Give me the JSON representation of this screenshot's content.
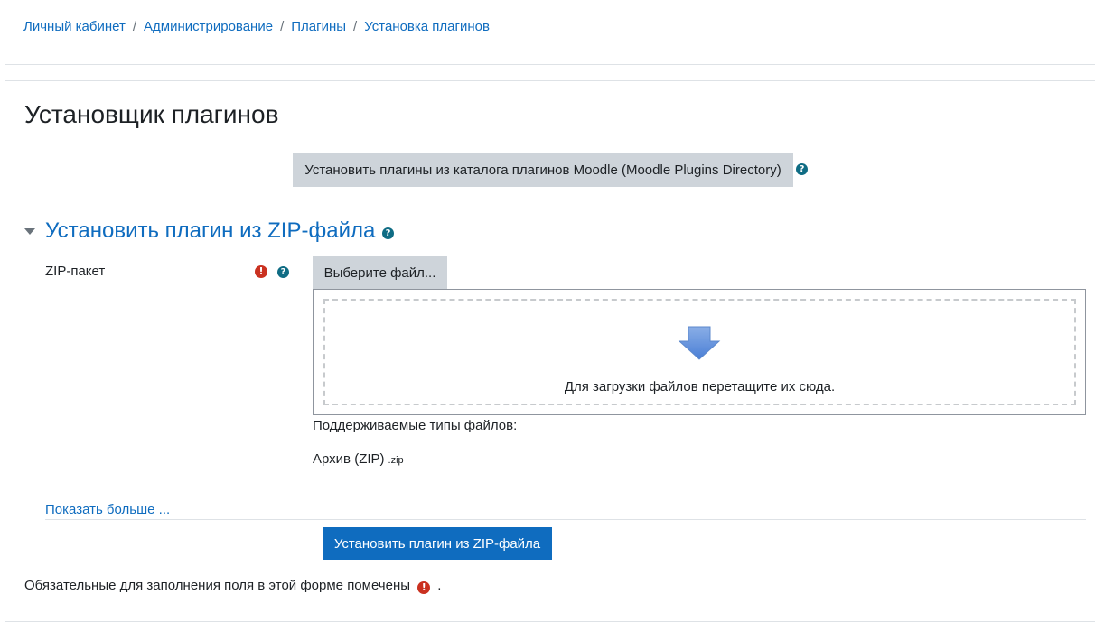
{
  "breadcrumb": {
    "items": [
      "Личный кабинет",
      "Администрирование",
      "Плагины",
      "Установка плагинов"
    ],
    "separator": "/"
  },
  "page": {
    "title": "Установщик плагинов"
  },
  "catalog": {
    "button_label": "Установить плагины из каталога плагинов Moodle (Moodle Plugins Directory)",
    "help_icon": "question-circle-icon"
  },
  "zip_section": {
    "title": "Установить плагин из ZIP-файла",
    "toggle_icon": "caret-down-icon",
    "help_icon": "question-circle-icon",
    "field_label": "ZIP-пакет",
    "required_icon": "exclamation-circle-icon",
    "choose_file_label": "Выберите файл...",
    "drop_text": "Для загрузки файлов перетащите их сюда.",
    "supported_label": "Поддерживаемые типы файлов:",
    "archive_type": "Архив (ZIP)",
    "archive_ext": ".zip",
    "show_more": "Показать больше ...",
    "install_button_label": "Установить плагин из ZIP-файла"
  },
  "footer": {
    "required_note": "Обязательные для заполнения поля в этой форме помечены",
    "required_note_end": "."
  },
  "colors": {
    "link": "#0f6cbf",
    "primary_button": "#0f6cbf",
    "secondary_button": "#ced4da",
    "help_icon": "#0f6c84",
    "required_icon": "#ca3120"
  }
}
